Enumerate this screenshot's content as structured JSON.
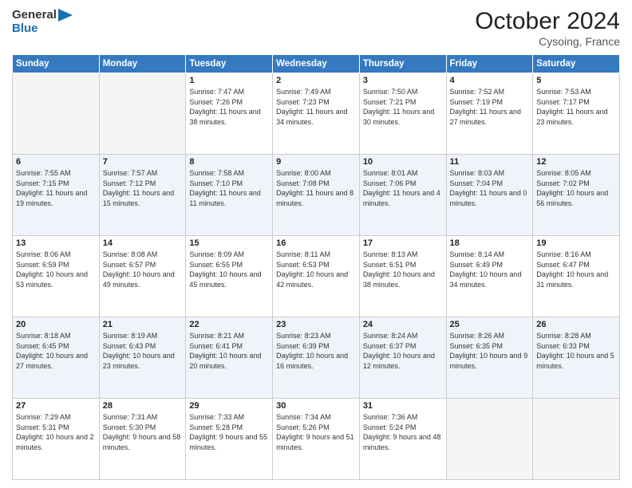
{
  "header": {
    "logo_line1": "General",
    "logo_line2": "Blue",
    "month": "October 2024",
    "location": "Cysoing, France"
  },
  "weekdays": [
    "Sunday",
    "Monday",
    "Tuesday",
    "Wednesday",
    "Thursday",
    "Friday",
    "Saturday"
  ],
  "weeks": [
    [
      {
        "day": "",
        "empty": true
      },
      {
        "day": "",
        "empty": true
      },
      {
        "day": "1",
        "sunrise": "7:47 AM",
        "sunset": "7:26 PM",
        "daylight": "11 hours and 38 minutes."
      },
      {
        "day": "2",
        "sunrise": "7:49 AM",
        "sunset": "7:23 PM",
        "daylight": "11 hours and 34 minutes."
      },
      {
        "day": "3",
        "sunrise": "7:50 AM",
        "sunset": "7:21 PM",
        "daylight": "11 hours and 30 minutes."
      },
      {
        "day": "4",
        "sunrise": "7:52 AM",
        "sunset": "7:19 PM",
        "daylight": "11 hours and 27 minutes."
      },
      {
        "day": "5",
        "sunrise": "7:53 AM",
        "sunset": "7:17 PM",
        "daylight": "11 hours and 23 minutes."
      }
    ],
    [
      {
        "day": "6",
        "sunrise": "7:55 AM",
        "sunset": "7:15 PM",
        "daylight": "11 hours and 19 minutes."
      },
      {
        "day": "7",
        "sunrise": "7:57 AM",
        "sunset": "7:12 PM",
        "daylight": "11 hours and 15 minutes."
      },
      {
        "day": "8",
        "sunrise": "7:58 AM",
        "sunset": "7:10 PM",
        "daylight": "11 hours and 11 minutes."
      },
      {
        "day": "9",
        "sunrise": "8:00 AM",
        "sunset": "7:08 PM",
        "daylight": "11 hours and 8 minutes."
      },
      {
        "day": "10",
        "sunrise": "8:01 AM",
        "sunset": "7:06 PM",
        "daylight": "11 hours and 4 minutes."
      },
      {
        "day": "11",
        "sunrise": "8:03 AM",
        "sunset": "7:04 PM",
        "daylight": "11 hours and 0 minutes."
      },
      {
        "day": "12",
        "sunrise": "8:05 AM",
        "sunset": "7:02 PM",
        "daylight": "10 hours and 56 minutes."
      }
    ],
    [
      {
        "day": "13",
        "sunrise": "8:06 AM",
        "sunset": "6:59 PM",
        "daylight": "10 hours and 53 minutes."
      },
      {
        "day": "14",
        "sunrise": "8:08 AM",
        "sunset": "6:57 PM",
        "daylight": "10 hours and 49 minutes."
      },
      {
        "day": "15",
        "sunrise": "8:09 AM",
        "sunset": "6:55 PM",
        "daylight": "10 hours and 45 minutes."
      },
      {
        "day": "16",
        "sunrise": "8:11 AM",
        "sunset": "6:53 PM",
        "daylight": "10 hours and 42 minutes."
      },
      {
        "day": "17",
        "sunrise": "8:13 AM",
        "sunset": "6:51 PM",
        "daylight": "10 hours and 38 minutes."
      },
      {
        "day": "18",
        "sunrise": "8:14 AM",
        "sunset": "6:49 PM",
        "daylight": "10 hours and 34 minutes."
      },
      {
        "day": "19",
        "sunrise": "8:16 AM",
        "sunset": "6:47 PM",
        "daylight": "10 hours and 31 minutes."
      }
    ],
    [
      {
        "day": "20",
        "sunrise": "8:18 AM",
        "sunset": "6:45 PM",
        "daylight": "10 hours and 27 minutes."
      },
      {
        "day": "21",
        "sunrise": "8:19 AM",
        "sunset": "6:43 PM",
        "daylight": "10 hours and 23 minutes."
      },
      {
        "day": "22",
        "sunrise": "8:21 AM",
        "sunset": "6:41 PM",
        "daylight": "10 hours and 20 minutes."
      },
      {
        "day": "23",
        "sunrise": "8:23 AM",
        "sunset": "6:39 PM",
        "daylight": "10 hours and 16 minutes."
      },
      {
        "day": "24",
        "sunrise": "8:24 AM",
        "sunset": "6:37 PM",
        "daylight": "10 hours and 12 minutes."
      },
      {
        "day": "25",
        "sunrise": "8:26 AM",
        "sunset": "6:35 PM",
        "daylight": "10 hours and 9 minutes."
      },
      {
        "day": "26",
        "sunrise": "8:28 AM",
        "sunset": "6:33 PM",
        "daylight": "10 hours and 5 minutes."
      }
    ],
    [
      {
        "day": "27",
        "sunrise": "7:29 AM",
        "sunset": "5:31 PM",
        "daylight": "10 hours and 2 minutes."
      },
      {
        "day": "28",
        "sunrise": "7:31 AM",
        "sunset": "5:30 PM",
        "daylight": "9 hours and 58 minutes."
      },
      {
        "day": "29",
        "sunrise": "7:33 AM",
        "sunset": "5:28 PM",
        "daylight": "9 hours and 55 minutes."
      },
      {
        "day": "30",
        "sunrise": "7:34 AM",
        "sunset": "5:26 PM",
        "daylight": "9 hours and 51 minutes."
      },
      {
        "day": "31",
        "sunrise": "7:36 AM",
        "sunset": "5:24 PM",
        "daylight": "9 hours and 48 minutes."
      },
      {
        "day": "",
        "empty": true
      },
      {
        "day": "",
        "empty": true
      }
    ]
  ]
}
